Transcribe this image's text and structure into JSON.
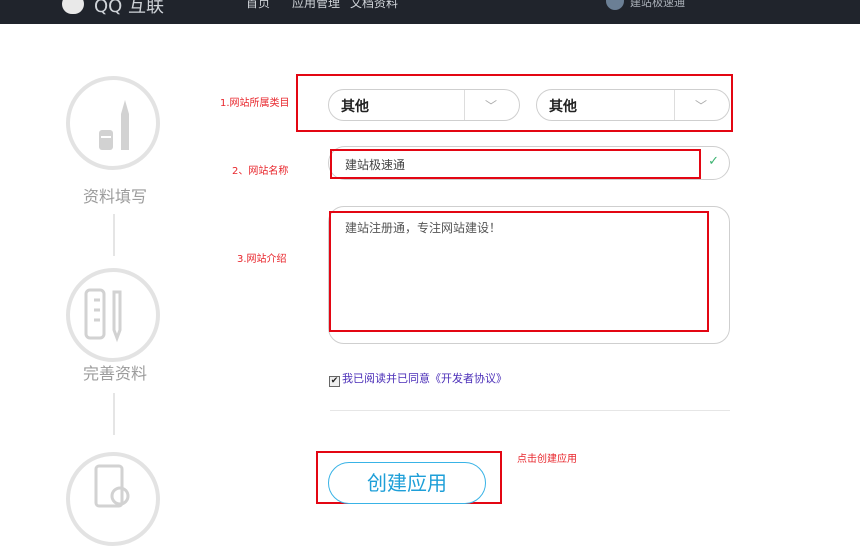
{
  "header": {
    "logo_text": "QQ 互联",
    "nav": [
      "首页",
      "应用管理",
      "文档资料"
    ],
    "username": "建站极速通"
  },
  "steps": [
    {
      "label": "资料填写",
      "icon": "pencil-icon"
    },
    {
      "label": "完善资料",
      "icon": "ruler-pen-icon"
    },
    {
      "label": "",
      "icon": "document-check-icon"
    }
  ],
  "form": {
    "category_label": "1.网站所属类目",
    "category_primary": "其他",
    "category_secondary": "其他",
    "name_label": "2、网站名称",
    "name_value": "建站极速通",
    "intro_label": "3.网站介绍",
    "intro_value": "建站注册通，专注网站建设！",
    "agree_text": "我已阅读并已同意《开发者协议》",
    "agree_checked": true,
    "create_note": "点击创建应用",
    "create_button": "创建应用"
  },
  "colors": {
    "annotation_red": "#e30613",
    "accent_blue": "#1e9fd8",
    "success_green": "#3cb371",
    "link_purple": "#4b2fb8"
  }
}
